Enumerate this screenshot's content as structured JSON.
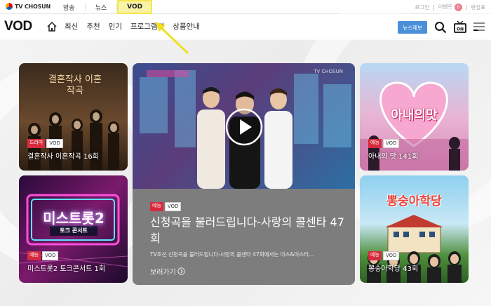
{
  "brand": {
    "logo_text": "TV CHOSUN"
  },
  "topnav": {
    "items": [
      "방송",
      "뉴스",
      "VOD"
    ]
  },
  "toputil": {
    "login": "로그인",
    "sep1": "|",
    "event": "이벤트",
    "event_badge": "0",
    "sep2": "|",
    "schedule": "편성표"
  },
  "mainbar": {
    "title": "VOD",
    "menu": [
      "최신",
      "추천",
      "인기",
      "프로그램별",
      "상품안내"
    ],
    "news_button": "뉴스제보"
  },
  "cards": [
    {
      "genre": "드라마",
      "vod": "VOD",
      "title": "결혼작사 이혼작곡 16회",
      "poster_text": "결혼작사 이혼작곡"
    },
    {
      "genre": "예능",
      "vod": "VOD",
      "title": "미스트롯2 토크콘서트 1회",
      "poster_text": "미스트롯2",
      "poster_sub": "토크 콘서트"
    },
    {
      "genre": "예능",
      "vod": "VOD",
      "title": "신청곡을 불러드립니다-사랑의 콜센타 47회",
      "description": "TV조선 신청곡을 불러드립니다-사랑의 콜센타 47회에서는 미스&미스터...",
      "more": "보러가기",
      "watermark": "TV CHOSUN"
    },
    {
      "genre": "예능",
      "vod": "VOD",
      "title": "아내의 맛 141회",
      "poster_text": "아내의맛"
    },
    {
      "genre": "예능",
      "vod": "VOD",
      "title": "뽕숭아학당 43회",
      "poster_text": "뽕숭아학당"
    }
  ],
  "colors": {
    "genre_badge": "#d62b3e",
    "news_button": "#4a90d9",
    "highlight": "#f9f3a6",
    "arrow": "#f0e020"
  }
}
